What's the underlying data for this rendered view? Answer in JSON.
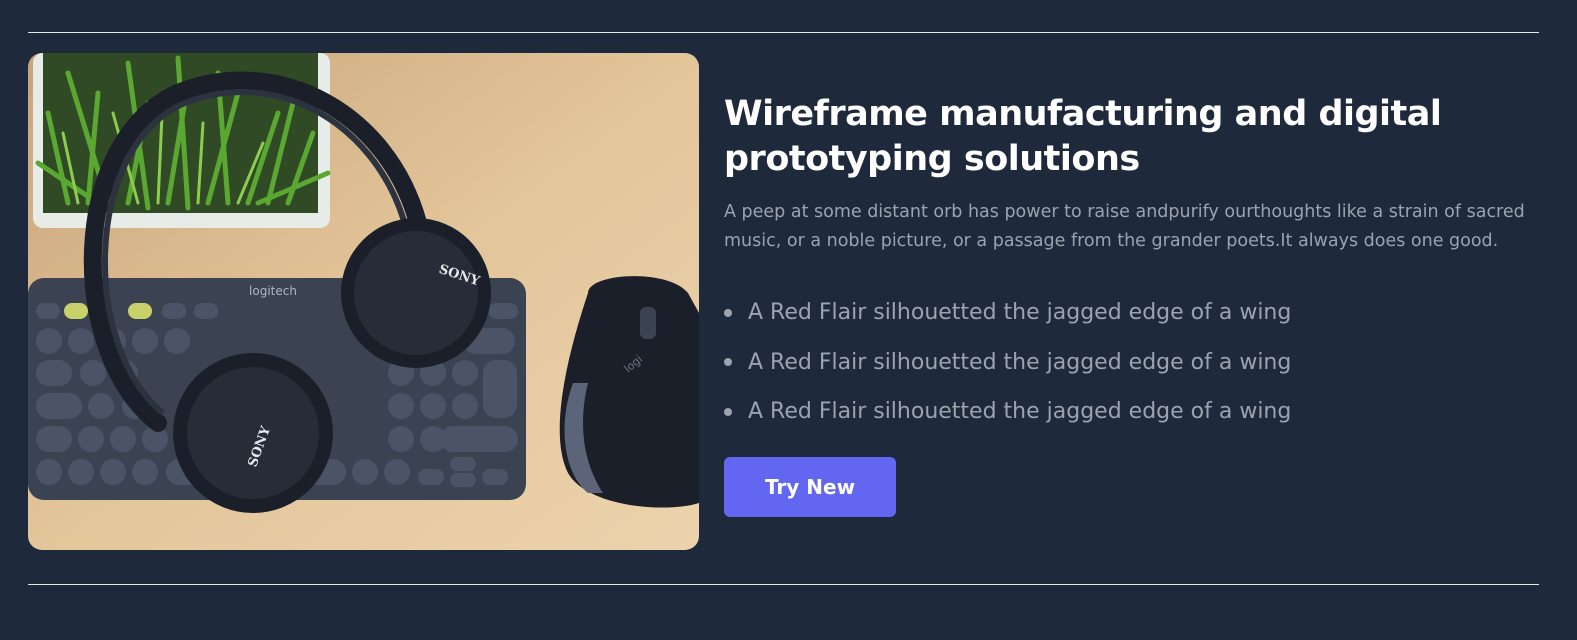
{
  "hero": {
    "image": {
      "alt": "Headphones, keyboard and mouse on a desk",
      "brand_logo": "logitech",
      "headphone_brand": "SONY",
      "mouse_logo": "logi",
      "colors": {
        "desk": "#e6c9a0",
        "device": "#3b4353",
        "plant": "#4a8f2a"
      }
    },
    "title": "Wireframe manufacturing and digital prototyping solutions",
    "description": "A peep at some distant orb has power to raise andpurify ourthoughts like a strain of sacred music, or a noble picture, or a passage from the grander poets.It always does one good.",
    "features": [
      "A Red Flair silhouetted the jagged edge of a wing",
      "A Red Flair silhouetted the jagged edge of a wing",
      "A Red Flair silhouetted the jagged edge of a wing"
    ],
    "cta_label": "Try New",
    "colors": {
      "background": "#1e293b",
      "accent": "#6366f1",
      "title": "#ffffff",
      "body_text": "#9ca3af"
    }
  }
}
